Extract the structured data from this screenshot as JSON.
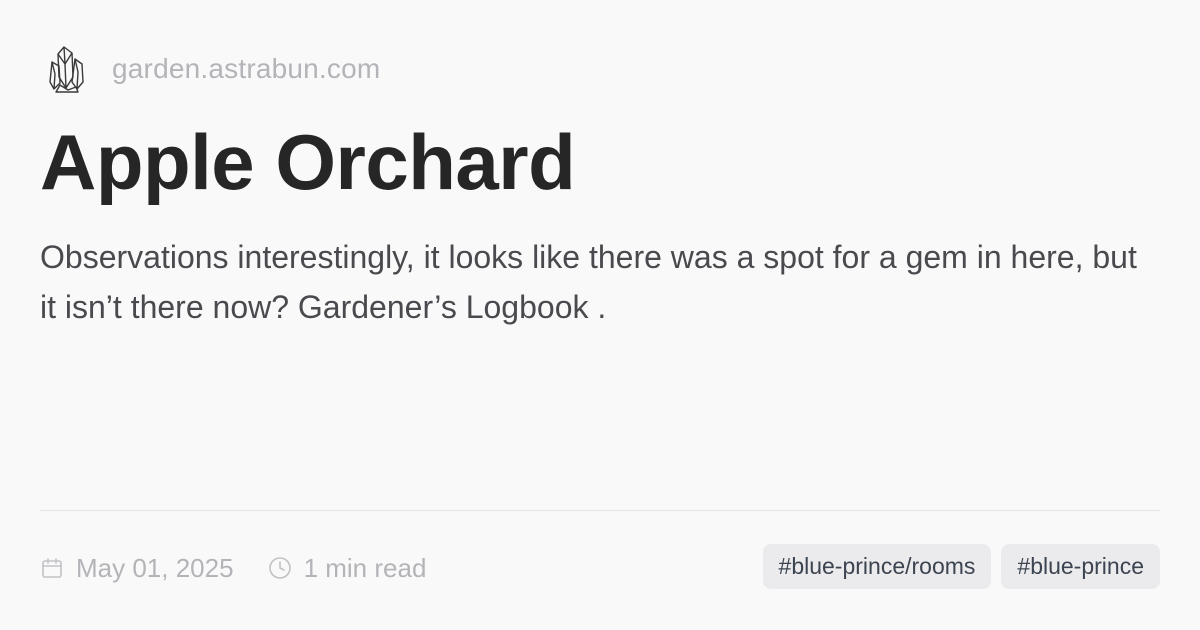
{
  "site": {
    "domain": "garden.astrabun.com",
    "logo_icon": "crystal-cluster-icon"
  },
  "post": {
    "title": "Apple Orchard",
    "description": "Observations interestingly, it looks like there was a spot for a gem in here, but it isn’t there now? Gardener’s Logbook ."
  },
  "meta": {
    "date": "May 01, 2025",
    "date_icon": "calendar-icon",
    "read_time": "1 min read",
    "read_time_icon": "clock-icon"
  },
  "tags": [
    {
      "label": "#blue-prince/rooms"
    },
    {
      "label": "#blue-prince"
    }
  ],
  "colors": {
    "background": "#faf9fa",
    "title": "#262626",
    "body_text": "#4a4a4e",
    "muted_text": "#b4b4b8",
    "tag_background": "#ebebee",
    "tag_text": "#3c4450"
  }
}
